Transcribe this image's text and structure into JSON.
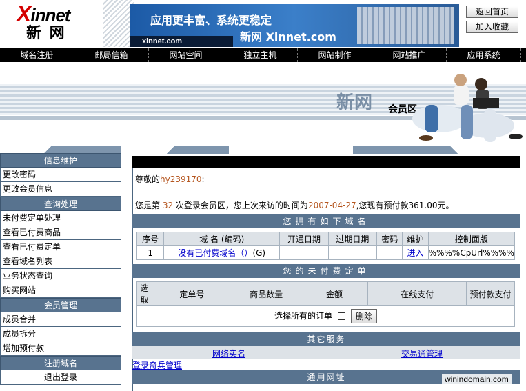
{
  "header": {
    "logo_latin": "innet",
    "logo_x": "X",
    "logo_cn": "新 网",
    "banner_slogan": "应用更丰富、系统更稳定",
    "banner_brand": "新网 Xinnet.com",
    "banner_url": "xinnet.com",
    "btn_home": "返回首页",
    "btn_favorite": "加入收藏"
  },
  "nav": [
    "域名注册",
    "邮局信箱",
    "网站空间",
    "独立主机",
    "网站制作",
    "网站推广",
    "应用系统"
  ],
  "member_banner": {
    "title": "新网",
    "subtitle": "会员区"
  },
  "sidebar": {
    "sections": [
      {
        "head": "信息维护",
        "items": [
          "更改密码",
          "更改会员信息"
        ]
      },
      {
        "head": "查询处理",
        "items": [
          "未付费定单处理",
          "查看已付费商品",
          "查看已付费定单",
          "查看域名列表",
          "业务状态查询",
          "购买网站"
        ]
      },
      {
        "head": "会员管理",
        "items": [
          "成员合并",
          "成员拆分",
          "增加预付款"
        ]
      },
      {
        "head": "注册域名",
        "items": [
          "退出登录"
        ]
      }
    ]
  },
  "main": {
    "greet_prefix": "尊敬的",
    "username": "hy239170",
    "greet_suffix": ":",
    "visit_prefix": "您是第 ",
    "visit_count": "32",
    "visit_middle": " 次登录会员区，您上次来访的时间为",
    "last_visit": "2007-04-27",
    "visit_suffix": ",您现有预付款361.00元。",
    "domains_title": "您拥有如下域名",
    "domains_headers": [
      "序号",
      "域 名 (编码)",
      "开通日期",
      "过期日期",
      "密码",
      "维护",
      "控制面版"
    ],
    "domains_row": [
      "1",
      "没有已付费域名（）",
      "(G)",
      "",
      "",
      "",
      "进入",
      "%%%%CpUrl%%%%"
    ],
    "orders_title": "您的未付费定单",
    "orders_headers": [
      "选取",
      "定单号",
      "商品数量",
      "金额",
      "在线支付",
      "预付款支付"
    ],
    "select_all_label": "选择所有的订单",
    "delete_button": "删除",
    "other_title": "其它服务",
    "other_links": [
      "网络实名",
      "交易通管理"
    ],
    "reg_link": "登录奇兵管理",
    "common_title": "通用网址"
  },
  "watermark": "winindomain.com"
}
